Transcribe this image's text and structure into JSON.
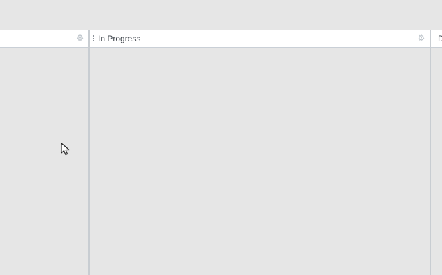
{
  "columns": [
    {
      "title": "",
      "gear_icon": "gear-icon"
    },
    {
      "title": "In Progress",
      "gear_icon": "gear-icon"
    },
    {
      "title": "D"
    }
  ],
  "colors": {
    "board_background": "#e6e6e6",
    "header_background": "#ffffff",
    "divider": "#c8cdd2",
    "title_text": "#3b4148",
    "icon": "#b9c0c7"
  }
}
